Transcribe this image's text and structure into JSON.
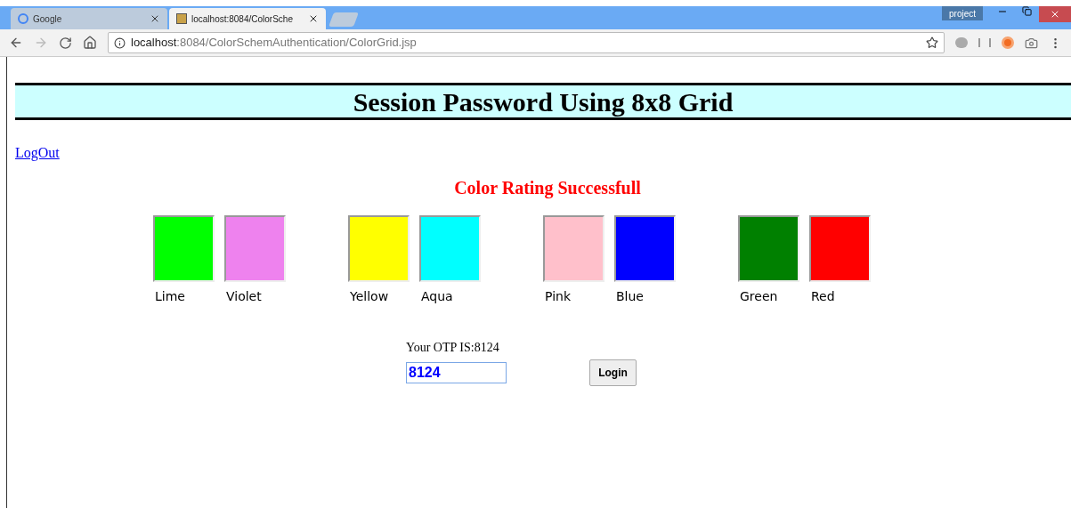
{
  "browser": {
    "tabs": [
      {
        "title": "Google",
        "selected": false
      },
      {
        "title": "localhost:8084/ColorSche",
        "selected": true
      }
    ],
    "profile": "project",
    "url_host": "localhost",
    "url_path": ":8084/ColorSchemAuthentication/ColorGrid.jsp"
  },
  "header": {
    "title": "Session Password Using 8x8 Grid"
  },
  "logout_link": "LogOut",
  "status_message": "Color Rating Successfull",
  "color_groups": [
    {
      "swatches": [
        {
          "name": "Lime",
          "color": "#00ff00"
        },
        {
          "name": "Violet",
          "color": "#ee82ee"
        }
      ]
    },
    {
      "swatches": [
        {
          "name": "Yellow",
          "color": "#ffff00"
        },
        {
          "name": "Aqua",
          "color": "#00ffff"
        }
      ]
    },
    {
      "swatches": [
        {
          "name": "Pink",
          "color": "#ffc0cb"
        },
        {
          "name": "Blue",
          "color": "#0000ff"
        }
      ]
    },
    {
      "swatches": [
        {
          "name": "Green",
          "color": "#008000"
        },
        {
          "name": "Red",
          "color": "#ff0000"
        }
      ]
    }
  ],
  "otp": {
    "label": "Your OTP IS:8124",
    "value": "8124"
  },
  "login_button": "Login"
}
